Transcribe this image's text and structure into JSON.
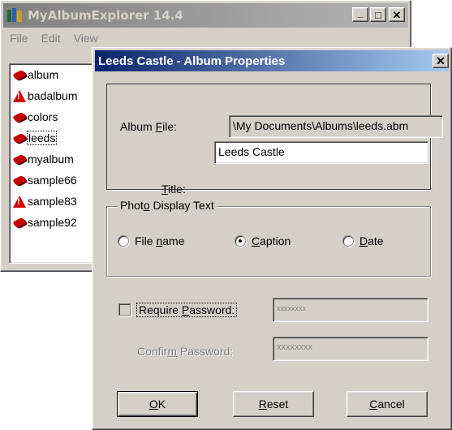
{
  "background_window": {
    "title": "MyAlbumExplorer 14.4",
    "menu": [
      "File",
      "Edit",
      "View"
    ],
    "list_items": [
      {
        "label": "album",
        "icon": "album-book-icon"
      },
      {
        "label": "badalbum",
        "icon": "warning-icon"
      },
      {
        "label": "colors",
        "icon": "album-book-icon"
      },
      {
        "label": "leeds",
        "icon": "album-book-icon",
        "selected": true
      },
      {
        "label": "myalbum",
        "icon": "album-book-icon"
      },
      {
        "label": "sample66",
        "icon": "album-book-icon"
      },
      {
        "label": "sample83",
        "icon": "warning-icon"
      },
      {
        "label": "sample92",
        "icon": "album-book-icon"
      }
    ],
    "caption_buttons": {
      "minimize": "_",
      "maximize": "□",
      "close": "✕"
    }
  },
  "dialog": {
    "title": "Leeds Castle - Album Properties",
    "close_glyph": "✕",
    "album_file_label_pre": "Album ",
    "album_file_label_key": "F",
    "album_file_label_post": "ile:",
    "album_file_value": "\\My Documents\\Albums\\leeds.abm",
    "title_label_key": "T",
    "title_label_post": "itle:",
    "title_value": "Leeds Castle",
    "photo_group_legend_pre": "Phot",
    "photo_group_legend_key": "o",
    "photo_group_legend_post": " Display Text",
    "radio_file_pre": "File ",
    "radio_file_key": "n",
    "radio_file_post": "ame",
    "radio_caption_key": "C",
    "radio_caption_post": "aption",
    "radio_date_key": "D",
    "radio_date_post": "ate",
    "selected_option": "Caption",
    "require_password_pre": "Require ",
    "require_password_key": "P",
    "require_password_post": "assword:",
    "require_password_checked": false,
    "password_mask": "xxxxxxxx",
    "confirm_password_pre": "Confir",
    "confirm_password_key": "m",
    "confirm_password_post": " Password:",
    "confirm_password_mask": "xxxxxxxx",
    "ok_key": "O",
    "ok_post": "K",
    "reset_key": "R",
    "reset_post": "eset",
    "cancel_key": "C",
    "cancel_post": "ancel"
  }
}
